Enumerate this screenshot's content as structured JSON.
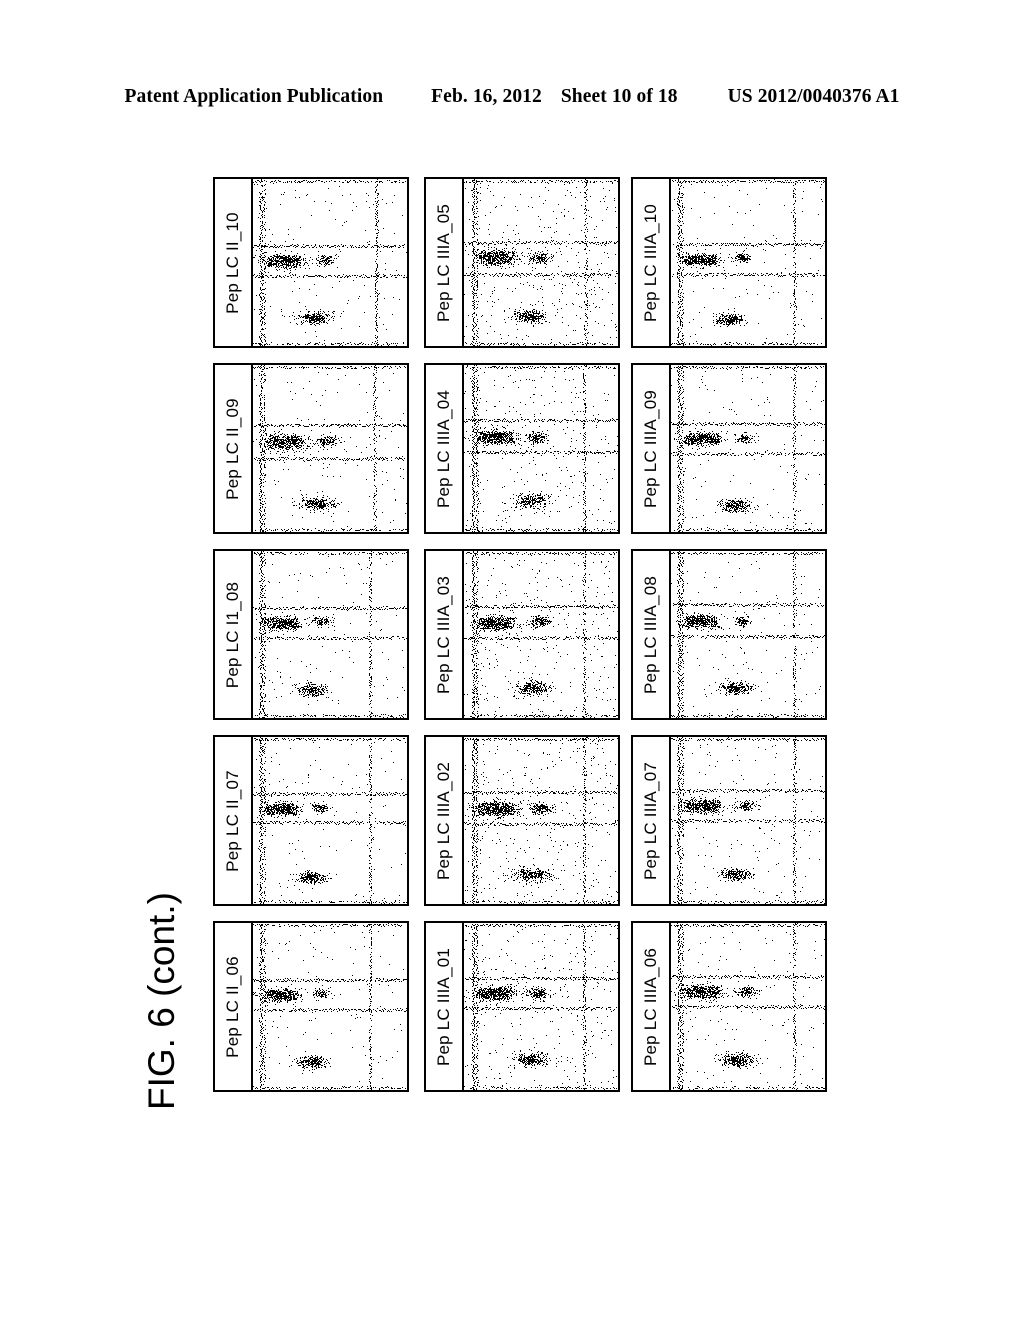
{
  "header": {
    "publication": "Patent Application Publication",
    "date": "Feb. 16, 2012",
    "sheet": "Sheet 10 of 18",
    "patent_number": "US 2012/0040376 A1"
  },
  "figure": {
    "caption": "FIG. 6 (cont.)"
  },
  "chart_data": {
    "type": "scatter",
    "title": "FIG. 6 (cont.)",
    "description": "Grid of 15 two-dimensional flow-cytometry style dot plots, 5 rows by 3 columns. Each plot carries a rotated sample label on a left-hand strip and shows dotted quadrant gate lines with dense dot clusters.",
    "grid": {
      "rows": 5,
      "cols": 3
    },
    "xlabel": "",
    "ylabel": "",
    "panels": [
      {
        "row": 1,
        "col": 1,
        "label": "Pep LC II_10",
        "gates": {
          "h1": 0.4,
          "h2": 0.58,
          "v1": 0.05,
          "v2": 0.8
        },
        "clusters": [
          {
            "name": "mid-left-dense",
            "cx": 0.2,
            "cy": 0.49,
            "rx": 0.16,
            "ry": 0.055,
            "n": 300
          },
          {
            "name": "mid-center",
            "cx": 0.47,
            "cy": 0.48,
            "rx": 0.08,
            "ry": 0.04,
            "n": 110
          },
          {
            "name": "lower-center",
            "cx": 0.4,
            "cy": 0.83,
            "rx": 0.13,
            "ry": 0.045,
            "n": 260
          }
        ],
        "sparse_density": 0.0018
      },
      {
        "row": 1,
        "col": 2,
        "label": "Pep LC IIIA_05",
        "gates": {
          "h1": 0.38,
          "h2": 0.57,
          "v1": 0.06,
          "v2": 0.79
        },
        "clusters": [
          {
            "name": "mid-left-dense",
            "cx": 0.21,
            "cy": 0.47,
            "rx": 0.17,
            "ry": 0.06,
            "n": 340
          },
          {
            "name": "mid-center",
            "cx": 0.49,
            "cy": 0.47,
            "rx": 0.09,
            "ry": 0.045,
            "n": 150
          },
          {
            "name": "lower-center",
            "cx": 0.42,
            "cy": 0.82,
            "rx": 0.13,
            "ry": 0.05,
            "n": 280
          }
        ],
        "sparse_density": 0.0042
      },
      {
        "row": 1,
        "col": 3,
        "label": "Pep LC IIIA_10",
        "gates": {
          "h1": 0.39,
          "h2": 0.57,
          "v1": 0.05,
          "v2": 0.8
        },
        "clusters": [
          {
            "name": "mid-left-dense",
            "cx": 0.19,
            "cy": 0.48,
            "rx": 0.15,
            "ry": 0.05,
            "n": 280
          },
          {
            "name": "mid-center",
            "cx": 0.46,
            "cy": 0.47,
            "rx": 0.07,
            "ry": 0.035,
            "n": 95
          },
          {
            "name": "lower-center",
            "cx": 0.38,
            "cy": 0.84,
            "rx": 0.11,
            "ry": 0.04,
            "n": 230
          }
        ],
        "sparse_density": 0.0016
      },
      {
        "row": 2,
        "col": 1,
        "label": "Pep LC II_09",
        "gates": {
          "h1": 0.36,
          "h2": 0.56,
          "v1": 0.05,
          "v2": 0.79
        },
        "clusters": [
          {
            "name": "mid-left-dense",
            "cx": 0.21,
            "cy": 0.46,
            "rx": 0.17,
            "ry": 0.06,
            "n": 330
          },
          {
            "name": "mid-center",
            "cx": 0.48,
            "cy": 0.45,
            "rx": 0.09,
            "ry": 0.04,
            "n": 130
          },
          {
            "name": "lower-center",
            "cx": 0.42,
            "cy": 0.83,
            "rx": 0.13,
            "ry": 0.045,
            "n": 270
          }
        ],
        "sparse_density": 0.0018
      },
      {
        "row": 2,
        "col": 2,
        "label": "Pep LC IIIA_04",
        "gates": {
          "h1": 0.33,
          "h2": 0.52,
          "v1": 0.06,
          "v2": 0.78
        },
        "clusters": [
          {
            "name": "mid-left-dense",
            "cx": 0.2,
            "cy": 0.43,
            "rx": 0.17,
            "ry": 0.055,
            "n": 350
          },
          {
            "name": "mid-center",
            "cx": 0.47,
            "cy": 0.43,
            "rx": 0.08,
            "ry": 0.04,
            "n": 140
          },
          {
            "name": "lower-center",
            "cx": 0.43,
            "cy": 0.81,
            "rx": 0.13,
            "ry": 0.05,
            "n": 270
          }
        ],
        "sparse_density": 0.0036
      },
      {
        "row": 2,
        "col": 3,
        "label": "Pep LC IIIA_09",
        "gates": {
          "h1": 0.35,
          "h2": 0.53,
          "v1": 0.05,
          "v2": 0.8
        },
        "clusters": [
          {
            "name": "mid-left-dense",
            "cx": 0.2,
            "cy": 0.44,
            "rx": 0.16,
            "ry": 0.05,
            "n": 300
          },
          {
            "name": "mid-center",
            "cx": 0.48,
            "cy": 0.44,
            "rx": 0.08,
            "ry": 0.035,
            "n": 110
          },
          {
            "name": "lower-center",
            "cx": 0.42,
            "cy": 0.84,
            "rx": 0.12,
            "ry": 0.045,
            "n": 250
          }
        ],
        "sparse_density": 0.0016
      },
      {
        "row": 3,
        "col": 1,
        "label": "Pep LC I1_08",
        "gates": {
          "h1": 0.34,
          "h2": 0.52,
          "v1": 0.05,
          "v2": 0.76
        },
        "clusters": [
          {
            "name": "mid-left-dense",
            "cx": 0.19,
            "cy": 0.43,
            "rx": 0.16,
            "ry": 0.05,
            "n": 300
          },
          {
            "name": "mid-center",
            "cx": 0.44,
            "cy": 0.42,
            "rx": 0.08,
            "ry": 0.035,
            "n": 110
          },
          {
            "name": "lower-center",
            "cx": 0.38,
            "cy": 0.83,
            "rx": 0.12,
            "ry": 0.045,
            "n": 250
          }
        ],
        "sparse_density": 0.0014
      },
      {
        "row": 3,
        "col": 2,
        "label": "Pep LC IIIA_03",
        "gates": {
          "h1": 0.33,
          "h2": 0.52,
          "v1": 0.06,
          "v2": 0.78
        },
        "clusters": [
          {
            "name": "mid-left-dense",
            "cx": 0.21,
            "cy": 0.43,
            "rx": 0.17,
            "ry": 0.055,
            "n": 340
          },
          {
            "name": "mid-center",
            "cx": 0.49,
            "cy": 0.42,
            "rx": 0.09,
            "ry": 0.04,
            "n": 150
          },
          {
            "name": "lower-center",
            "cx": 0.44,
            "cy": 0.82,
            "rx": 0.13,
            "ry": 0.05,
            "n": 280
          }
        ],
        "sparse_density": 0.004
      },
      {
        "row": 3,
        "col": 3,
        "label": "Pep LC IIIA_08",
        "gates": {
          "h1": 0.32,
          "h2": 0.51,
          "v1": 0.05,
          "v2": 0.8
        },
        "clusters": [
          {
            "name": "mid-left-dense",
            "cx": 0.19,
            "cy": 0.42,
            "rx": 0.15,
            "ry": 0.05,
            "n": 290
          },
          {
            "name": "mid-center",
            "cx": 0.46,
            "cy": 0.42,
            "rx": 0.07,
            "ry": 0.035,
            "n": 95
          },
          {
            "name": "lower-center",
            "cx": 0.42,
            "cy": 0.82,
            "rx": 0.12,
            "ry": 0.045,
            "n": 260
          }
        ],
        "sparse_density": 0.0016
      },
      {
        "row": 4,
        "col": 1,
        "label": "Pep LC II_07",
        "gates": {
          "h1": 0.34,
          "h2": 0.51,
          "v1": 0.05,
          "v2": 0.76
        },
        "clusters": [
          {
            "name": "mid-left-dense",
            "cx": 0.18,
            "cy": 0.43,
            "rx": 0.15,
            "ry": 0.05,
            "n": 290
          },
          {
            "name": "mid-center",
            "cx": 0.44,
            "cy": 0.42,
            "rx": 0.07,
            "ry": 0.035,
            "n": 95
          },
          {
            "name": "lower-center",
            "cx": 0.38,
            "cy": 0.84,
            "rx": 0.12,
            "ry": 0.04,
            "n": 240
          }
        ],
        "sparse_density": 0.0014
      },
      {
        "row": 4,
        "col": 2,
        "label": "Pep LC IIIA_02",
        "gates": {
          "h1": 0.33,
          "h2": 0.52,
          "v1": 0.06,
          "v2": 0.78
        },
        "clusters": [
          {
            "name": "mid-left-dense",
            "cx": 0.21,
            "cy": 0.43,
            "rx": 0.18,
            "ry": 0.06,
            "n": 370
          },
          {
            "name": "mid-center",
            "cx": 0.5,
            "cy": 0.43,
            "rx": 0.09,
            "ry": 0.04,
            "n": 160
          },
          {
            "name": "lower-center",
            "cx": 0.44,
            "cy": 0.82,
            "rx": 0.14,
            "ry": 0.05,
            "n": 290
          }
        ],
        "sparse_density": 0.0042
      },
      {
        "row": 4,
        "col": 3,
        "label": "Pep LC IIIA_07",
        "gates": {
          "h1": 0.32,
          "h2": 0.5,
          "v1": 0.05,
          "v2": 0.8
        },
        "clusters": [
          {
            "name": "mid-left-dense",
            "cx": 0.2,
            "cy": 0.41,
            "rx": 0.17,
            "ry": 0.055,
            "n": 320
          },
          {
            "name": "mid-center",
            "cx": 0.48,
            "cy": 0.41,
            "rx": 0.08,
            "ry": 0.035,
            "n": 120
          },
          {
            "name": "lower-center",
            "cx": 0.42,
            "cy": 0.82,
            "rx": 0.12,
            "ry": 0.045,
            "n": 260
          }
        ],
        "sparse_density": 0.0018
      },
      {
        "row": 5,
        "col": 1,
        "label": "Pep LC II_06",
        "gates": {
          "h1": 0.34,
          "h2": 0.52,
          "v1": 0.05,
          "v2": 0.76
        },
        "clusters": [
          {
            "name": "mid-left-dense",
            "cx": 0.18,
            "cy": 0.43,
            "rx": 0.16,
            "ry": 0.05,
            "n": 300
          },
          {
            "name": "mid-center",
            "cx": 0.44,
            "cy": 0.42,
            "rx": 0.07,
            "ry": 0.035,
            "n": 95
          },
          {
            "name": "lower-center",
            "cx": 0.38,
            "cy": 0.83,
            "rx": 0.12,
            "ry": 0.045,
            "n": 250
          }
        ],
        "sparse_density": 0.0014
      },
      {
        "row": 5,
        "col": 2,
        "label": "Pep LC IIIA_01",
        "gates": {
          "h1": 0.33,
          "h2": 0.51,
          "v1": 0.06,
          "v2": 0.78
        },
        "clusters": [
          {
            "name": "mid-left-dense",
            "cx": 0.2,
            "cy": 0.42,
            "rx": 0.16,
            "ry": 0.055,
            "n": 330
          },
          {
            "name": "mid-center",
            "cx": 0.48,
            "cy": 0.42,
            "rx": 0.09,
            "ry": 0.04,
            "n": 150
          },
          {
            "name": "lower-center",
            "cx": 0.43,
            "cy": 0.82,
            "rx": 0.13,
            "ry": 0.05,
            "n": 270
          }
        ],
        "sparse_density": 0.0038
      },
      {
        "row": 5,
        "col": 3,
        "label": "Pep LC IIIA_06",
        "gates": {
          "h1": 0.32,
          "h2": 0.5,
          "v1": 0.05,
          "v2": 0.8
        },
        "clusters": [
          {
            "name": "mid-left-dense",
            "cx": 0.2,
            "cy": 0.41,
            "rx": 0.17,
            "ry": 0.055,
            "n": 320
          },
          {
            "name": "mid-center",
            "cx": 0.49,
            "cy": 0.41,
            "rx": 0.08,
            "ry": 0.04,
            "n": 130
          },
          {
            "name": "lower-center",
            "cx": 0.43,
            "cy": 0.82,
            "rx": 0.13,
            "ry": 0.05,
            "n": 280
          }
        ],
        "sparse_density": 0.0018
      }
    ]
  }
}
